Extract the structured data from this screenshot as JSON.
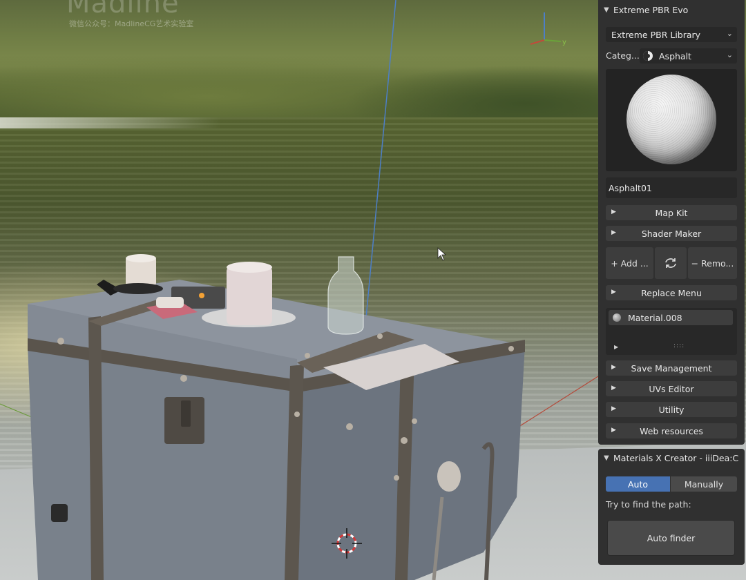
{
  "watermark": {
    "logo": "Madline",
    "subtitle": "微信公众号：MadlineCG艺术实验室"
  },
  "pbr_panel": {
    "title": "Extreme PBR Evo",
    "library_select": "Extreme PBR Library",
    "category_label": "Categ...",
    "category_value": "Asphalt",
    "material_name": "Asphalt01",
    "subpanels": {
      "map_kit": "Map Kit",
      "shader_maker": "Shader Maker",
      "replace_menu": "Replace Menu",
      "save_management": "Save Management",
      "uvs_editor": "UVs Editor",
      "utility": "Utility",
      "web_resources": "Web resources"
    },
    "buttons": {
      "add": "+ Add ...",
      "remove": "− Remo..."
    },
    "material_list": [
      "Material.008"
    ],
    "list_grip": "::::"
  },
  "mx_panel": {
    "title": "Materials X Creator - iiiDea:C",
    "mode_auto": "Auto",
    "mode_manual": "Manually",
    "active_mode": "Auto",
    "hint": "Try to find the path:",
    "finder_button": "Auto finder"
  },
  "colors": {
    "accent": "#4772b3",
    "panel_bg": "#303030",
    "field_bg": "#282828"
  }
}
